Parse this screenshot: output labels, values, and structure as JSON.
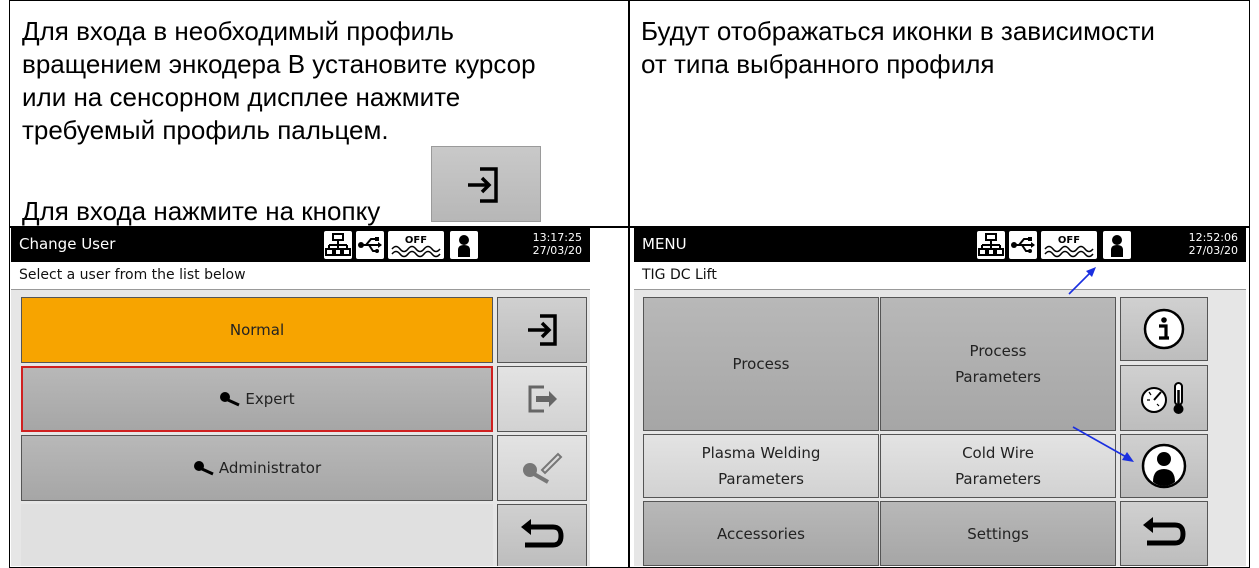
{
  "left_text": {
    "lines": [
      "Для входа в необходимый профиль",
      "вращением энкодера В установите курсор",
      "или на сенсорном дисплее нажмите",
      "требуемый профиль пальцем.",
      "",
      "Для входа нажмите на кнопку"
    ]
  },
  "right_text": {
    "lines": [
      "Будут отображаться иконки в зависимости",
      "от типа выбранного профиля"
    ]
  },
  "screen_left": {
    "title": "Change User",
    "time": "13:17:25",
    "date": "27/03/20",
    "off_label": "OFF",
    "subtitle": "Select a user from the list below",
    "users": [
      "Normal",
      "Expert",
      "Administrator"
    ],
    "selected_user": "Normal",
    "highlighted_user": "Expert",
    "side_buttons": [
      "enter-icon",
      "exit-icon",
      "key-edit-icon",
      "back-icon"
    ]
  },
  "screen_right": {
    "title": "MENU",
    "time": "12:52:06",
    "date": "27/03/20",
    "off_label": "OFF",
    "subtitle": "TIG  DC  Lift",
    "menu": {
      "process": "Process",
      "process_params_1": "Process",
      "process_params_2": "Parameters",
      "plasma_1": "Plasma Welding",
      "plasma_2": "Parameters",
      "cold_1": "Cold Wire",
      "cold_2": "Parameters",
      "accessories": "Accessories",
      "settings": "Settings"
    },
    "side_buttons": [
      "info-icon",
      "gauge-thermometer-icon",
      "user-profile-icon",
      "back-icon"
    ]
  },
  "colors": {
    "selected": "#f7a400",
    "highlight_border": "#d02020",
    "arrow": "#1a2fe0"
  }
}
